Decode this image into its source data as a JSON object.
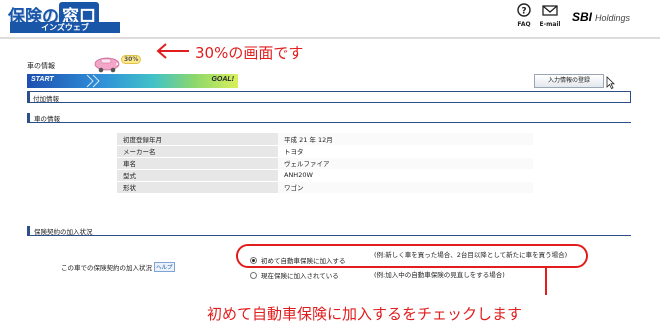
{
  "header": {
    "logo_main": "保険の",
    "logo_mado": "窓口",
    "logo_sub": "インズウェブ",
    "faq_label": "FAQ",
    "mail_label": "E-mail",
    "sbi_mark": "SBI",
    "sbi_text": "Holdings"
  },
  "progress": {
    "page_title": "車の情報",
    "percent_badge": "30%",
    "percent_value": 30,
    "start_label": "START",
    "goal_label": "GOAL!",
    "input_info_button": "入力情報の登録"
  },
  "annotations": {
    "top_note": "30%の画面です",
    "bottom_note": "初めて自動車保険に加入するをチェックします"
  },
  "sections": {
    "additional": "付加情報",
    "vehicle": "車の情報",
    "insurance": "保険契約の加入状況"
  },
  "vehicle_info": [
    {
      "label": "初度登録年月",
      "value": "平成 21 年 12月"
    },
    {
      "label": "メーカー名",
      "value": "トヨタ"
    },
    {
      "label": "車名",
      "value": "ヴェルファイア"
    },
    {
      "label": "型式",
      "value": "ANH20W"
    },
    {
      "label": "形状",
      "value": "ワゴン"
    }
  ],
  "insurance_status": {
    "label": "この車での保険契約の加入状況",
    "help": "ヘルプ",
    "options": [
      {
        "label": "初めて自動車保険に加入する",
        "example": "(例:新しく車を買った場合、2台目以降として新たに車を買う場合)",
        "selected": true
      },
      {
        "label": "現在保険に加入されている",
        "example": "(例:加入中の自動車保険の見直しをする場合)",
        "selected": false
      }
    ]
  },
  "colors": {
    "accent_red": "#e11d1d",
    "section_blue": "#2a4f8a",
    "brand_blue": "#1a56a8"
  },
  "icons": [
    "help-icon",
    "mail-icon",
    "car-icon",
    "arrow-left-icon",
    "mouse-cursor-icon"
  ]
}
